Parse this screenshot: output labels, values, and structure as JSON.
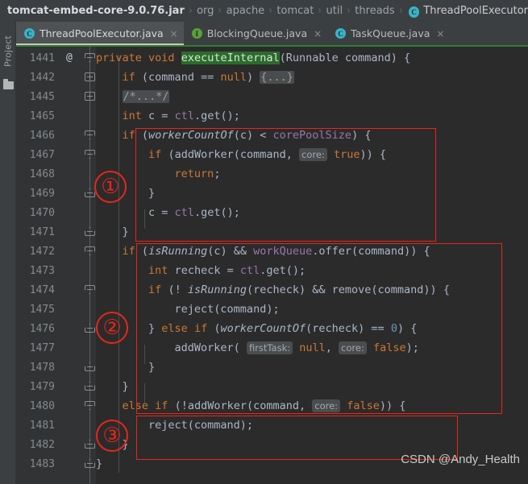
{
  "window": {
    "theme_bg": "#2b2b2b",
    "chrome_bg": "#3c3f41",
    "accent_red": "#e8261b"
  },
  "breadcrumb": {
    "jar": "tomcat-embed-core-9.0.76.jar",
    "separator": "›",
    "segments": [
      "org",
      "apache",
      "tomcat",
      "util",
      "threads"
    ],
    "class_icon": "C",
    "class_name": "ThreadPoolExecutor"
  },
  "tool_stripe": {
    "project_label": "Project",
    "folder_icon": "folder-icon"
  },
  "tabs": [
    {
      "icon": "C",
      "icon_kind": "class",
      "label": "ThreadPoolExecutor.java",
      "close": "×",
      "active": true
    },
    {
      "icon": "I",
      "icon_kind": "interface",
      "label": "BlockingQueue.java",
      "close": "×",
      "active": false
    },
    {
      "icon": "C",
      "icon_kind": "class",
      "label": "TaskQueue.java",
      "close": "×",
      "active": false
    }
  ],
  "editor": {
    "annotation_marker": "@",
    "lines": [
      {
        "no": "1441",
        "fold": "start",
        "annotation": "@"
      },
      {
        "no": "1442",
        "fold": "plus",
        "annotation": ""
      },
      {
        "no": "1445",
        "fold": "plus",
        "annotation": ""
      },
      {
        "no": "1465",
        "fold": "none",
        "annotation": ""
      },
      {
        "no": "1466",
        "fold": "start",
        "annotation": ""
      },
      {
        "no": "1467",
        "fold": "start",
        "annotation": ""
      },
      {
        "no": "1468",
        "fold": "none",
        "annotation": ""
      },
      {
        "no": "1469",
        "fold": "end",
        "annotation": ""
      },
      {
        "no": "1470",
        "fold": "none",
        "annotation": ""
      },
      {
        "no": "1471",
        "fold": "end",
        "annotation": ""
      },
      {
        "no": "1472",
        "fold": "start",
        "annotation": ""
      },
      {
        "no": "1473",
        "fold": "none",
        "annotation": ""
      },
      {
        "no": "1474",
        "fold": "start",
        "annotation": ""
      },
      {
        "no": "1475",
        "fold": "none",
        "annotation": ""
      },
      {
        "no": "1476",
        "fold": "end",
        "annotation": ""
      },
      {
        "no": "1477",
        "fold": "none",
        "annotation": ""
      },
      {
        "no": "1478",
        "fold": "end",
        "annotation": ""
      },
      {
        "no": "1479",
        "fold": "end",
        "annotation": ""
      },
      {
        "no": "1480",
        "fold": "start",
        "annotation": ""
      },
      {
        "no": "1481",
        "fold": "none",
        "annotation": ""
      },
      {
        "no": "1482",
        "fold": "end",
        "annotation": ""
      },
      {
        "no": "1483",
        "fold": "end",
        "annotation": ""
      }
    ],
    "code_text": [
      "private void executeInternal(Runnable command) {",
      "    if (command == null) {...}",
      "    /*...*/",
      "    int c = ctl.get();",
      "    if (workerCountOf(c) < corePoolSize) {",
      "        if (addWorker(command, core: true)) {",
      "            return;",
      "        }",
      "        c = ctl.get();",
      "    }",
      "    if (isRunning(c) && workQueue.offer(command)) {",
      "        int recheck = ctl.get();",
      "        if (! isRunning(recheck) && remove(command)) {",
      "            reject(command);",
      "        } else if (workerCountOf(recheck) == 0) {",
      "            addWorker( firstTask: null, core: false);",
      "        }",
      "    }",
      "    else if (!addWorker(command, core: false)) {",
      "        reject(command);",
      "    }",
      "}"
    ],
    "parameter_hints": [
      "core:",
      "firstTask:",
      "core:",
      "core:"
    ],
    "folded_placeholders": [
      "{...}",
      "/*...*/"
    ],
    "highlighted_method": "executeInternal"
  },
  "annotations": {
    "boxes": [
      {
        "label": "1",
        "name": "annotation-box-core-pool"
      },
      {
        "label": "2",
        "name": "annotation-box-work-queue"
      },
      {
        "label": "3",
        "name": "annotation-box-add-worker"
      }
    ],
    "circle_labels": [
      "①",
      "②",
      "③"
    ]
  },
  "watermark": {
    "text": "CSDN @Andy_Health"
  }
}
